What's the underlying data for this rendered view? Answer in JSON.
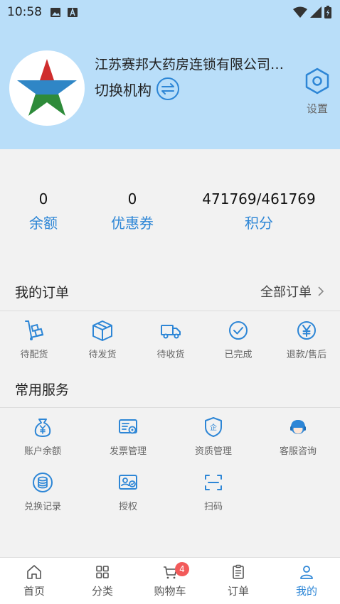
{
  "status_bar": {
    "time": "10:58"
  },
  "profile": {
    "company_name": "江苏赛邦大药房连锁有限公司…",
    "switch_label": "切换机构",
    "settings_label": "设置"
  },
  "stats": [
    {
      "value": "0",
      "label": "余额"
    },
    {
      "value": "0",
      "label": "优惠券"
    },
    {
      "value": "471769/461769",
      "label": "积分"
    }
  ],
  "orders": {
    "title": "我的订单",
    "all_label": "全部订单",
    "items": [
      {
        "label": "待配货",
        "icon": "cart-dolly-icon"
      },
      {
        "label": "待发货",
        "icon": "package-icon"
      },
      {
        "label": "待收货",
        "icon": "truck-icon"
      },
      {
        "label": "已完成",
        "icon": "check-circle-icon"
      },
      {
        "label": "退款/售后",
        "icon": "yen-circle-icon"
      }
    ]
  },
  "services": {
    "title": "常用服务",
    "items": [
      {
        "label": "账户余额",
        "icon": "money-bag-icon"
      },
      {
        "label": "发票管理",
        "icon": "invoice-icon"
      },
      {
        "label": "资质管理",
        "icon": "shield-icon"
      },
      {
        "label": "客服咨询",
        "icon": "support-agent-icon"
      },
      {
        "label": "兑换记录",
        "icon": "coins-icon"
      },
      {
        "label": "授权",
        "icon": "authorization-icon"
      },
      {
        "label": "扫码",
        "icon": "scan-icon"
      }
    ]
  },
  "tabbar": {
    "items": [
      {
        "label": "首页",
        "icon": "home-icon"
      },
      {
        "label": "分类",
        "icon": "grid-icon"
      },
      {
        "label": "购物车",
        "icon": "cart-icon",
        "badge": "4"
      },
      {
        "label": "订单",
        "icon": "order-list-icon"
      },
      {
        "label": "我的",
        "icon": "user-icon",
        "active": true
      }
    ]
  },
  "colors": {
    "accent": "#2d86d6",
    "header_bg": "#b9def9",
    "badge": "#f25a5a"
  }
}
